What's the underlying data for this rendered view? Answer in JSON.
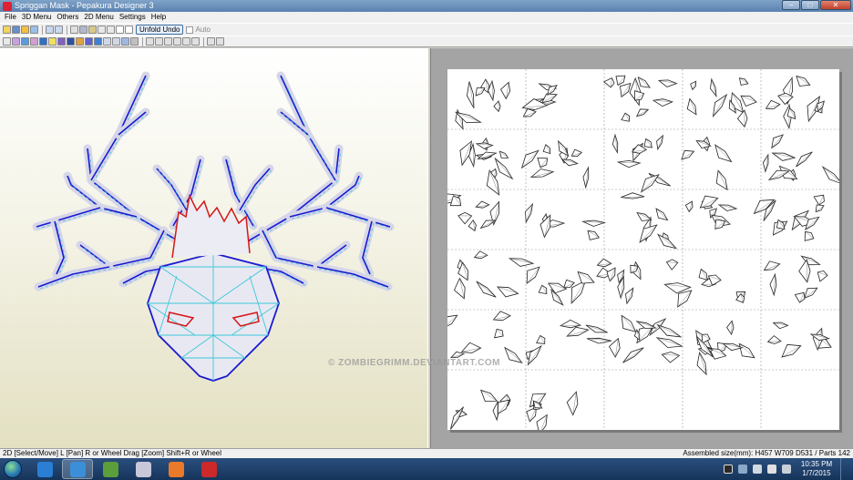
{
  "window": {
    "title": "Spriggan Mask - Pepakura Designer 3",
    "controls": {
      "minimize": "–",
      "maximize": "□",
      "close": "✕"
    }
  },
  "menu": {
    "items": [
      "File",
      "3D Menu",
      "Others",
      "2D Menu",
      "Settings",
      "Help"
    ]
  },
  "toolbar": {
    "unfold_undo_label": "Unfold Undo",
    "auto_label": "Auto",
    "auto_checked": false
  },
  "viewport3d": {
    "model": "spriggan-mask-wireframe",
    "colors": {
      "edge": "#1a1ad0",
      "fold": "#3cc8d8",
      "cut": "#d41818",
      "face": "#d6d6e8"
    }
  },
  "viewport2d": {
    "layout": {
      "columns": 5,
      "rows": 6,
      "filled_pages": 27
    }
  },
  "watermark": "© ZOMBIEGRIMM.DEVIANTART.COM",
  "status": {
    "left": "2D [Select/Move] L [Pan] R or Wheel Drag [Zoom] Shift+R or Wheel",
    "right": "Assembled size(mm): H457 W709 D531 / Parts 142"
  },
  "taskbar": {
    "apps": [
      {
        "name": "internet-explorer-icon",
        "color": "#2a7fd4"
      },
      {
        "name": "pepakura-icon",
        "color": "#3a8fd8",
        "active": true
      },
      {
        "name": "minecraft-icon",
        "color": "#5c9d3c"
      },
      {
        "name": "media-player-icon",
        "color": "#c8c8d8"
      },
      {
        "name": "photo-app-icon",
        "color": "#e87a2a"
      },
      {
        "name": "shape-app-icon",
        "color": "#cc2a2a"
      }
    ],
    "clock": {
      "time": "10:35 PM",
      "date": "1/7/2015"
    }
  }
}
